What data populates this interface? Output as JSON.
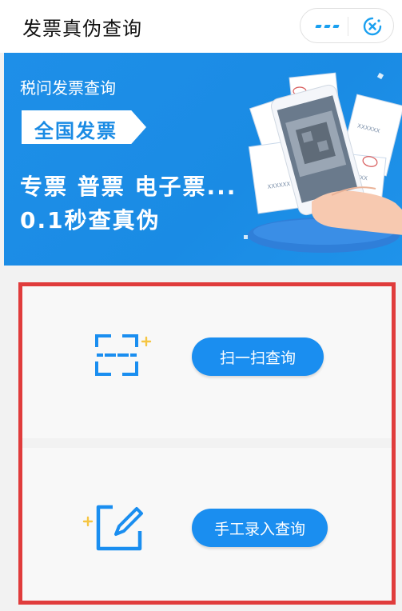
{
  "header": {
    "title": "发票真伪查询",
    "menu_icon": "more-dots-icon",
    "close_icon": "close-target-icon"
  },
  "banner": {
    "brand": "税问发票查询",
    "tag": "全国发票",
    "line1": "专票 普票 电子票...",
    "line2": "0.1秒查真伪",
    "art_icon": "phone-scanning-invoices-illustration",
    "invoice_text": "XXXXXX"
  },
  "actions": {
    "scan_label": "扫一扫查询",
    "scan_icon": "scan-frame-icon",
    "manual_label": "手工录入查询",
    "manual_icon": "edit-icon"
  },
  "colors": {
    "accent": "#1a8ef0",
    "banner": "#1e8fe8",
    "highlight": "#e03c3c",
    "sparkle": "#f5c542"
  }
}
